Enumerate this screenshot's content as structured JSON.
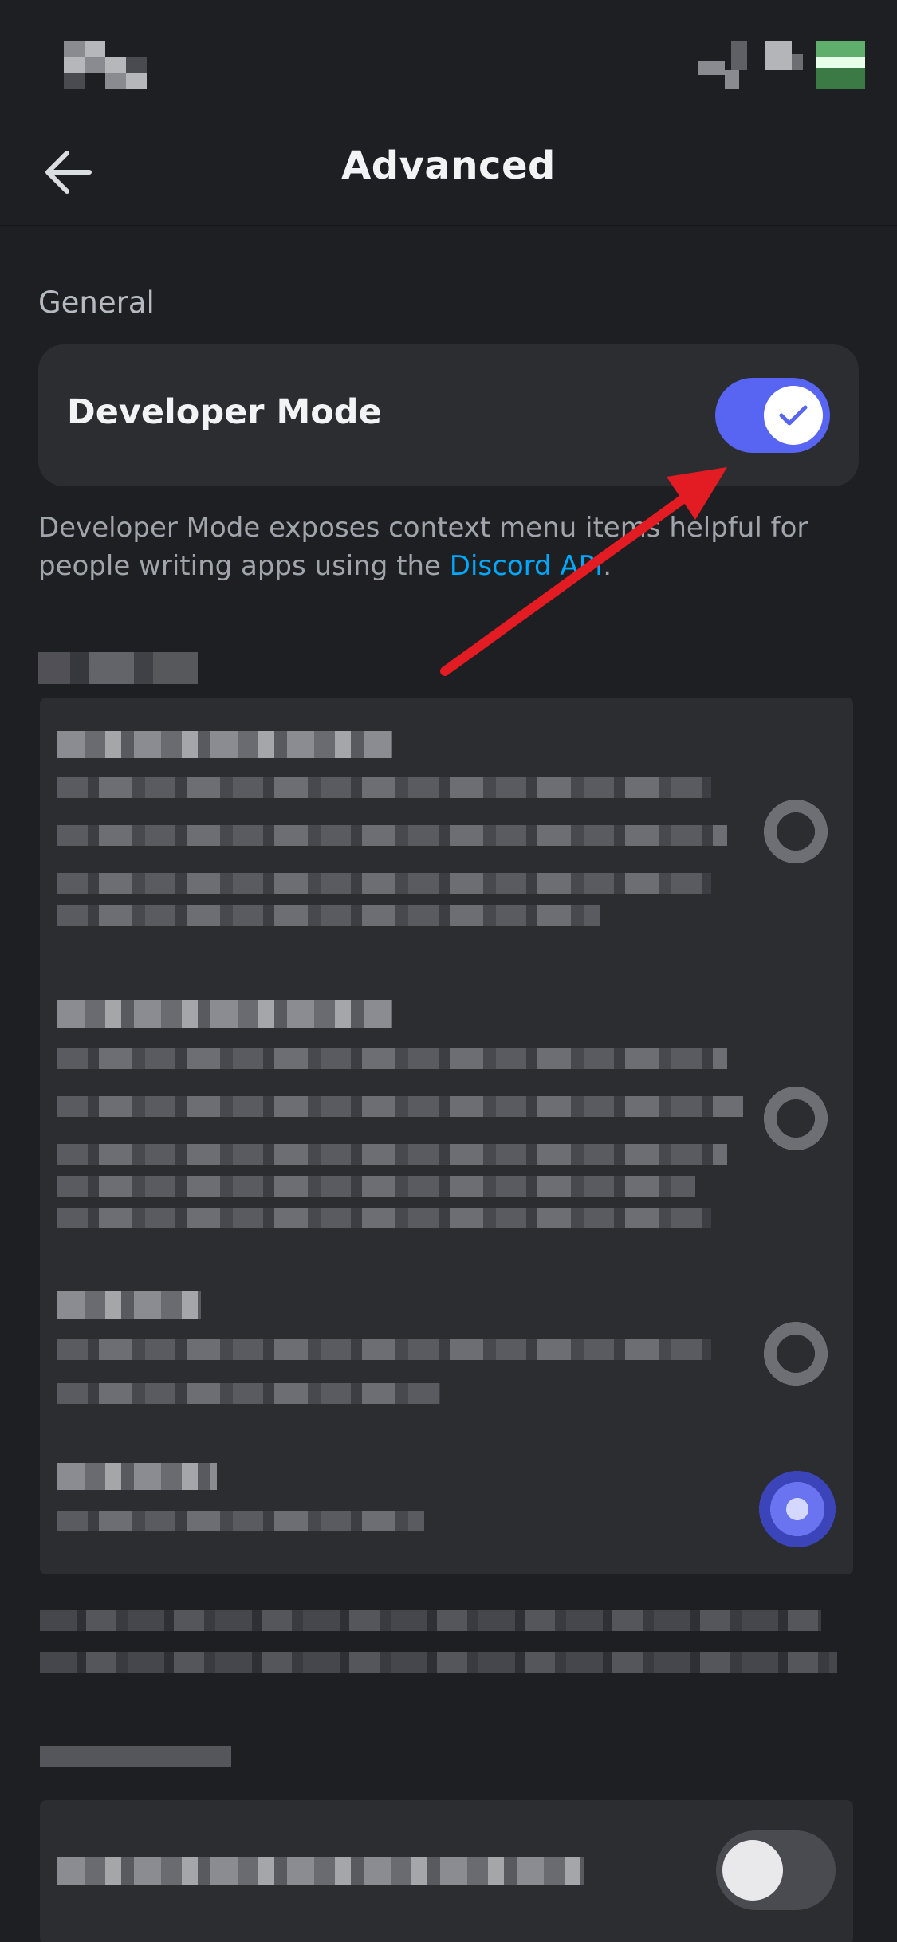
{
  "header": {
    "title": "Advanced",
    "back_icon": "arrow-left-icon"
  },
  "general_section": {
    "label": "General"
  },
  "developer_mode": {
    "label": "Developer Mode",
    "enabled": true,
    "toggle_color": "#5865f2",
    "check_icon": "checkmark-icon"
  },
  "description": {
    "text_before": "Developer Mode exposes context menu items helpful for people writing apps using the ",
    "link_text": "Discord API",
    "text_after": "."
  },
  "colors": {
    "background": "#1e1f22",
    "card": "#2b2d31",
    "accent": "#5865f2",
    "link": "#00a8fc",
    "annotation_arrow": "#e31b23"
  }
}
